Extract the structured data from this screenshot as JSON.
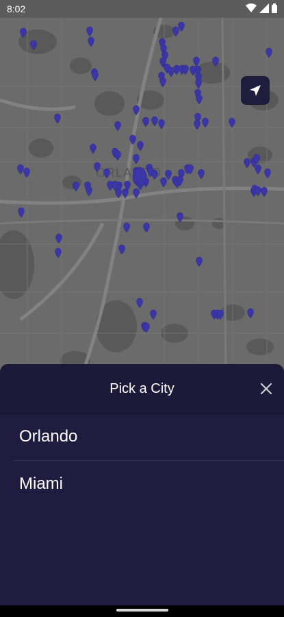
{
  "status_bar": {
    "time": "8:02",
    "icons": [
      "wifi-icon",
      "signal-icon",
      "battery-icon"
    ]
  },
  "map": {
    "city_label": "ORLANDO",
    "pin_color": "#3a36a8"
  },
  "locate_button": {
    "icon": "navigation-arrow-icon"
  },
  "sheet": {
    "title": "Pick a City",
    "close_icon": "close-icon",
    "cities": [
      {
        "label": "Orlando"
      },
      {
        "label": "Miami"
      }
    ]
  },
  "colors": {
    "sheet_bg": "#1e1c3f",
    "header_bg": "#1b1a38",
    "text": "#ffffff"
  }
}
